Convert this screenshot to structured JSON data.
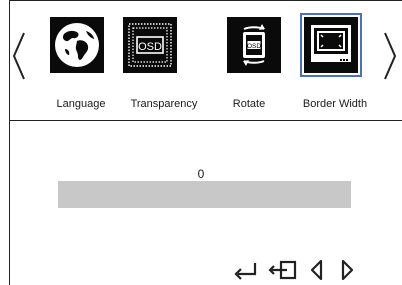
{
  "menu": {
    "items": [
      {
        "label": "Language",
        "icon": "globe-icon"
      },
      {
        "label": "Transparency",
        "icon": "osd-transparency-icon",
        "badge": "OSD"
      },
      {
        "label": "Rotate",
        "icon": "osd-rotate-icon",
        "badge": "OSD"
      },
      {
        "label": "Border Width",
        "icon": "monitor-border-icon",
        "selected": true
      }
    ]
  },
  "setting": {
    "value": "0",
    "level_fraction": 0
  },
  "nav": {
    "buttons": [
      "enter-icon",
      "exit-icon",
      "left-icon",
      "right-icon"
    ]
  },
  "colors": {
    "selection_outline": "#4a6fc0",
    "bar_track": "#c8c8c8",
    "tile_background": "#0a0a0a"
  }
}
